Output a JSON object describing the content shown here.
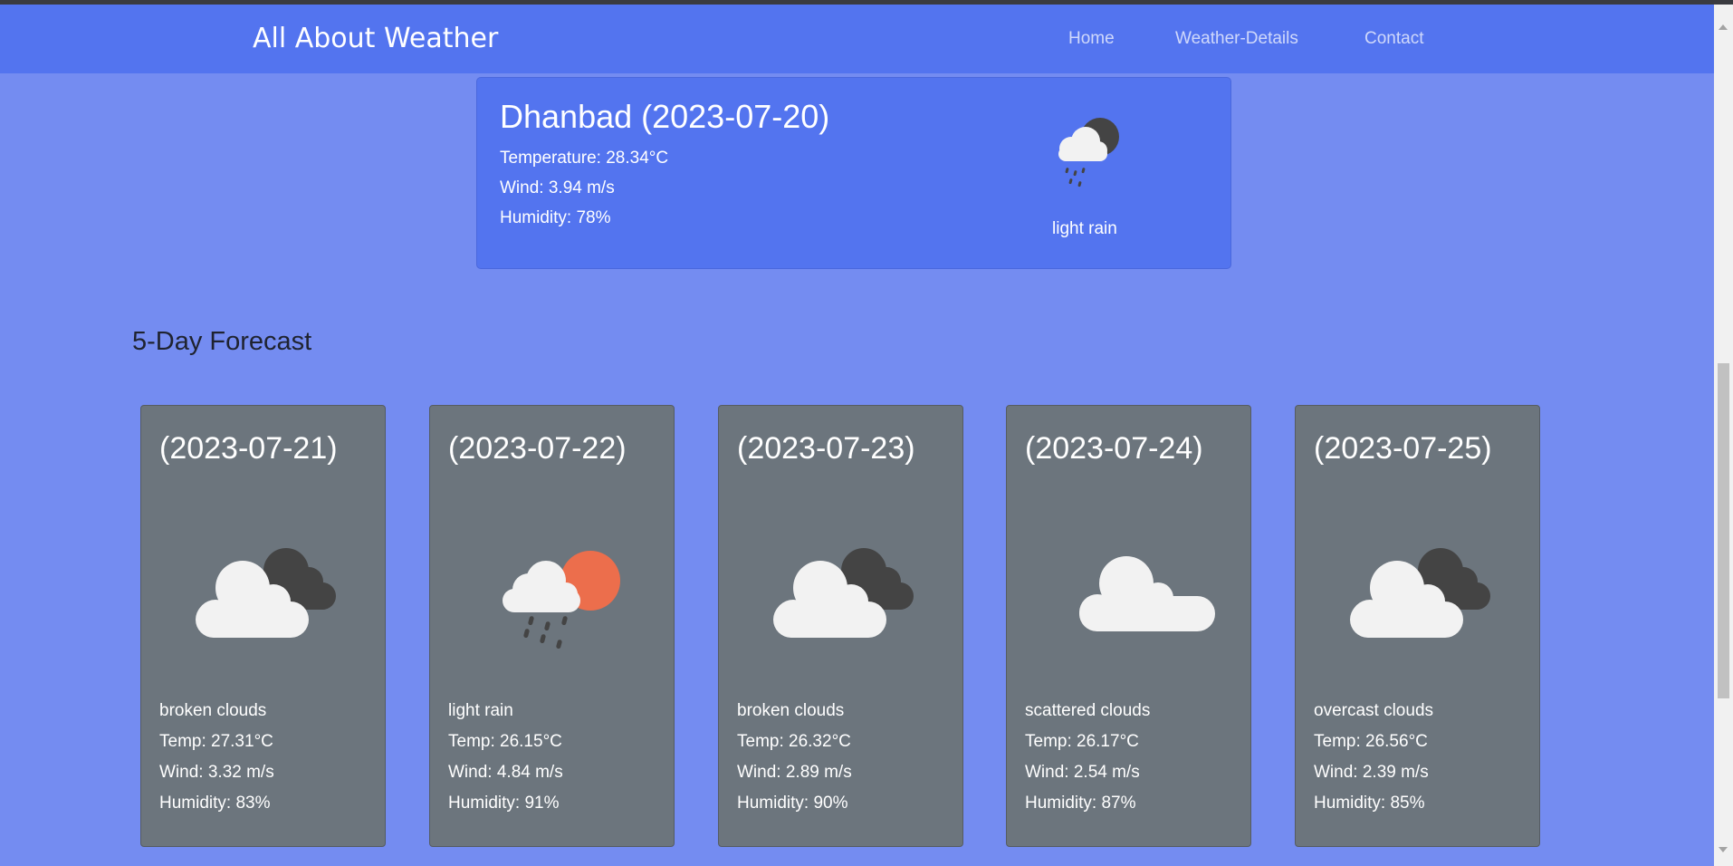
{
  "header": {
    "brand": "All About Weather",
    "nav": [
      "Home",
      "Weather-Details",
      "Contact"
    ]
  },
  "current": {
    "title": "Dhanbad (2023-07-20)",
    "temperature": "Temperature: 28.34°C",
    "wind": "Wind: 3.94 m/s",
    "humidity": "Humidity: 78%",
    "description": "light rain",
    "icon": "rain-night-icon"
  },
  "forecast": {
    "heading": "5-Day Forecast",
    "days": [
      {
        "date": "(2023-07-21)",
        "description": "broken clouds",
        "temp": "Temp: 27.31°C",
        "wind": "Wind: 3.32 m/s",
        "humidity": "Humidity: 83%",
        "icon": "broken-clouds-icon"
      },
      {
        "date": "(2023-07-22)",
        "description": "light rain",
        "temp": "Temp: 26.15°C",
        "wind": "Wind: 4.84 m/s",
        "humidity": "Humidity: 91%",
        "icon": "rain-day-icon"
      },
      {
        "date": "(2023-07-23)",
        "description": "broken clouds",
        "temp": "Temp: 26.32°C",
        "wind": "Wind: 2.89 m/s",
        "humidity": "Humidity: 90%",
        "icon": "broken-clouds-icon"
      },
      {
        "date": "(2023-07-24)",
        "description": "scattered clouds",
        "temp": "Temp: 26.17°C",
        "wind": "Wind: 2.54 m/s",
        "humidity": "Humidity: 87%",
        "icon": "scattered-clouds-icon"
      },
      {
        "date": "(2023-07-25)",
        "description": "overcast clouds",
        "temp": "Temp: 26.56°C",
        "wind": "Wind: 2.39 m/s",
        "humidity": "Humidity: 85%",
        "icon": "overcast-clouds-icon"
      }
    ]
  },
  "colors": {
    "page_bg": "#748cf1",
    "navbar_bg": "#5374ef",
    "card_bg": "#6c757d",
    "sun": "#ec6e4c",
    "dark_cloud": "#444444",
    "light_cloud": "#f2f2f2"
  }
}
